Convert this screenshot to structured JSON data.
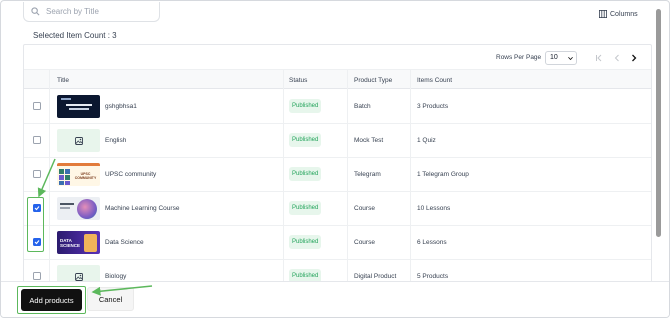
{
  "search": {
    "placeholder": "Search by Title"
  },
  "toolbar": {
    "columns_label": "Columns"
  },
  "selection": {
    "label": "Selected Item Count : 3"
  },
  "pagination": {
    "rows_per_page_label": "Rows Per Page",
    "rows_per_page_value": "10"
  },
  "table": {
    "headers": {
      "title": "Title",
      "status": "Status",
      "product_type": "Product Type",
      "items_count": "Items Count"
    },
    "rows": [
      {
        "title": "gshgbhsa1",
        "status": "Published",
        "product_type": "Batch",
        "items_count": "3 Products",
        "checked": false,
        "thumb": "dark-banner"
      },
      {
        "title": "English",
        "status": "Published",
        "product_type": "Mock Test",
        "items_count": "1 Quiz",
        "checked": false,
        "thumb": "image-placeholder"
      },
      {
        "title": "UPSC community",
        "status": "Published",
        "product_type": "Telegram",
        "items_count": "1 Telegram Group",
        "checked": false,
        "thumb": "upsc-community-banner"
      },
      {
        "title": "Machine Learning Course",
        "status": "Published",
        "product_type": "Course",
        "items_count": "10 Lessons",
        "checked": true,
        "thumb": "machine-learning-banner"
      },
      {
        "title": "Data Science",
        "status": "Published",
        "product_type": "Course",
        "items_count": "6 Lessons",
        "checked": true,
        "thumb": "data-science-banner"
      },
      {
        "title": "Biology",
        "status": "Published",
        "product_type": "Digital Product",
        "items_count": "5 Products",
        "checked": false,
        "thumb": "image-placeholder"
      }
    ]
  },
  "actions": {
    "add_label": "Add products",
    "cancel_label": "Cancel"
  },
  "thumb_texts": {
    "data_science": "DATA SCIENCE",
    "upsc": "UPSC COMMUNITY"
  },
  "colors": {
    "accent_green": "#5cb85c",
    "published_bg": "#e7f6ec",
    "published_text": "#22a35a",
    "checkbox_blue": "#2563eb",
    "primary_button": "#111111"
  }
}
